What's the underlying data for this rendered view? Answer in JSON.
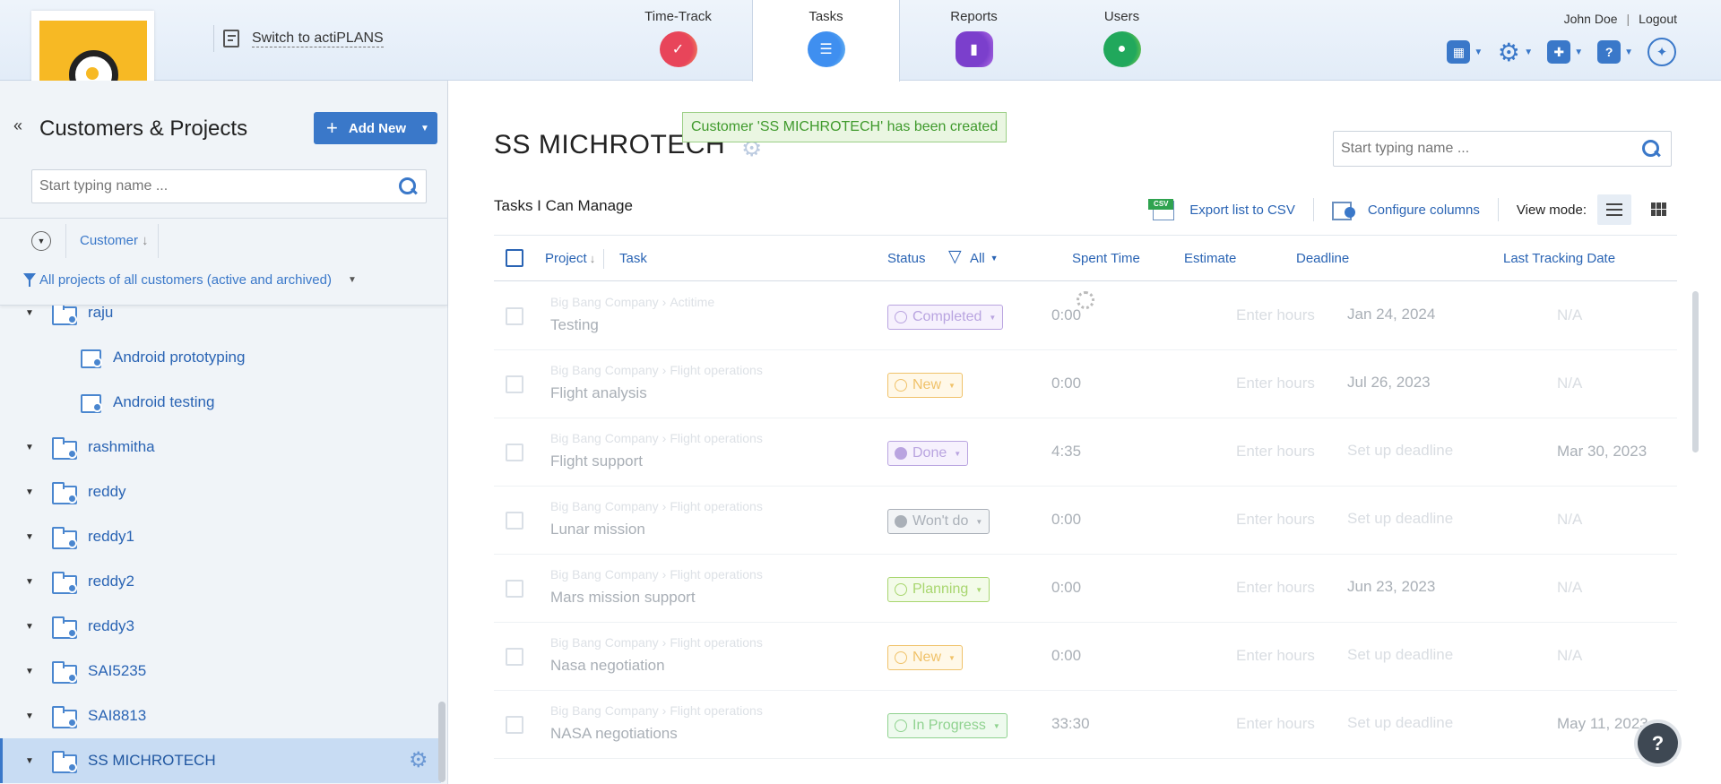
{
  "header": {
    "switch_label": "Switch to actiPLANS",
    "tabs": [
      {
        "label": "Time-Track",
        "icon": "check-icon"
      },
      {
        "label": "Tasks",
        "icon": "task-list-icon"
      },
      {
        "label": "Reports",
        "icon": "bar-chart-icon"
      },
      {
        "label": "Users",
        "icon": "user-icon"
      }
    ],
    "active_tab": "Tasks",
    "user_name": "John Doe",
    "separator": "|",
    "logout_label": "Logout"
  },
  "sidebar": {
    "title": "Customers & Projects",
    "add_new_label": "Add New",
    "search_placeholder": "Start typing name ...",
    "sort_label": "Customer",
    "filter_label": "All projects of all customers (active and archived)",
    "tree": [
      {
        "label": "raju",
        "type": "customer"
      },
      {
        "label": "Android prototyping",
        "type": "project"
      },
      {
        "label": "Android testing",
        "type": "project"
      },
      {
        "label": "rashmitha",
        "type": "customer"
      },
      {
        "label": "reddy",
        "type": "customer"
      },
      {
        "label": "reddy1",
        "type": "customer"
      },
      {
        "label": "reddy2",
        "type": "customer"
      },
      {
        "label": "reddy3",
        "type": "customer"
      },
      {
        "label": "SAI5235",
        "type": "customer"
      },
      {
        "label": "SAI8813",
        "type": "customer"
      },
      {
        "label": "SS MICHROTECH",
        "type": "customer",
        "selected": true
      }
    ]
  },
  "main": {
    "toast": "Customer 'SS MICHROTECH' has been created",
    "customer_title": "SS MICHROTECH",
    "search_placeholder": "Start typing name ...",
    "subtitle": "Tasks I Can Manage",
    "export_label": "Export list to CSV",
    "csv_tag": "CSV",
    "configure_label": "Configure columns",
    "view_mode_label": "View mode:",
    "columns": {
      "project": "Project",
      "task": "Task",
      "status": "Status",
      "status_filter": "All",
      "spent": "Spent Time",
      "estimate": "Estimate",
      "deadline": "Deadline",
      "last_tracking": "Last Tracking Date"
    },
    "rows": [
      {
        "customer": "Big Bang Company",
        "project": "Actitime",
        "task": "Testing",
        "status": "Completed",
        "status_color": "#b9a4e0",
        "status_bg": "#f6f1fd",
        "spent": "0:00",
        "estimate": "Enter hours",
        "deadline": "Jan 24, 2024",
        "deadline_placeholder": false,
        "last_tracking": "N/A"
      },
      {
        "customer": "Big Bang Company",
        "project": "Flight operations",
        "task": "Flight analysis",
        "status": "New",
        "status_color": "#f0c26a",
        "status_bg": "#fff8e8",
        "spent": "0:00",
        "estimate": "Enter hours",
        "deadline": "Jul 26, 2023",
        "deadline_placeholder": false,
        "last_tracking": "N/A"
      },
      {
        "customer": "Big Bang Company",
        "project": "Flight operations",
        "task": "Flight support",
        "status": "Done",
        "status_color": "#b9a4e0",
        "status_bg": "#f6f1fd",
        "spent": "4:35",
        "estimate": "Enter hours",
        "deadline": "Set up deadline",
        "deadline_placeholder": true,
        "last_tracking": "Mar 30, 2023"
      },
      {
        "customer": "Big Bang Company",
        "project": "Flight operations",
        "task": "Lunar mission",
        "status": "Won't do",
        "status_color": "#aab0b8",
        "status_bg": "#f2f4f6",
        "spent": "0:00",
        "estimate": "Enter hours",
        "deadline": "Set up deadline",
        "deadline_placeholder": true,
        "last_tracking": "N/A"
      },
      {
        "customer": "Big Bang Company",
        "project": "Flight operations",
        "task": "Mars mission support",
        "status": "Planning",
        "status_color": "#a8d66f",
        "status_bg": "#f3fbe9",
        "spent": "0:00",
        "estimate": "Enter hours",
        "deadline": "Jun 23, 2023",
        "deadline_placeholder": false,
        "last_tracking": "N/A"
      },
      {
        "customer": "Big Bang Company",
        "project": "Flight operations",
        "task": "Nasa negotiation",
        "status": "New",
        "status_color": "#f0c26a",
        "status_bg": "#fff8e8",
        "spent": "0:00",
        "estimate": "Enter hours",
        "deadline": "Set up deadline",
        "deadline_placeholder": true,
        "last_tracking": "N/A"
      },
      {
        "customer": "Big Bang Company",
        "project": "Flight operations",
        "task": "NASA negotiations",
        "status": "In Progress",
        "status_color": "#8fd28f",
        "status_bg": "#eefaee",
        "spent": "33:30",
        "estimate": "Enter hours",
        "deadline": "Set up deadline",
        "deadline_placeholder": true,
        "last_tracking": "May 11, 2023"
      }
    ],
    "help_label": "?"
  }
}
